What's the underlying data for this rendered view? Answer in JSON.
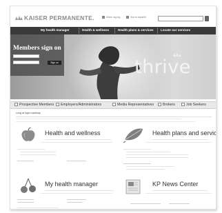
{
  "header": {
    "logo": "KAISER PERMANENTE.",
    "links": [
      "Home log.org",
      "Sul en español"
    ],
    "search_placeholder": ""
  },
  "nav": {
    "tabs": [
      "My health manager",
      "Health & wellness",
      "Health plans & services",
      "Locate our services"
    ]
  },
  "signin": {
    "title": "Members sign on",
    "button": "Sign on",
    "help": "",
    "links": [
      "",
      ""
    ]
  },
  "hero": {
    "tagline": "thrive"
  },
  "audience": {
    "items": [
      "Prospective Members",
      "Employers/Administrators",
      "Media Representatives",
      "Brokers",
      "Job Seekers"
    ]
  },
  "breadcrumb": "Long at login roadmap",
  "sections": {
    "wellness": {
      "title": "Health and wellness"
    },
    "plans": {
      "title": "Health plans and services"
    },
    "manager": {
      "title": "My health manager"
    },
    "news": {
      "title": "KP News Center"
    }
  }
}
